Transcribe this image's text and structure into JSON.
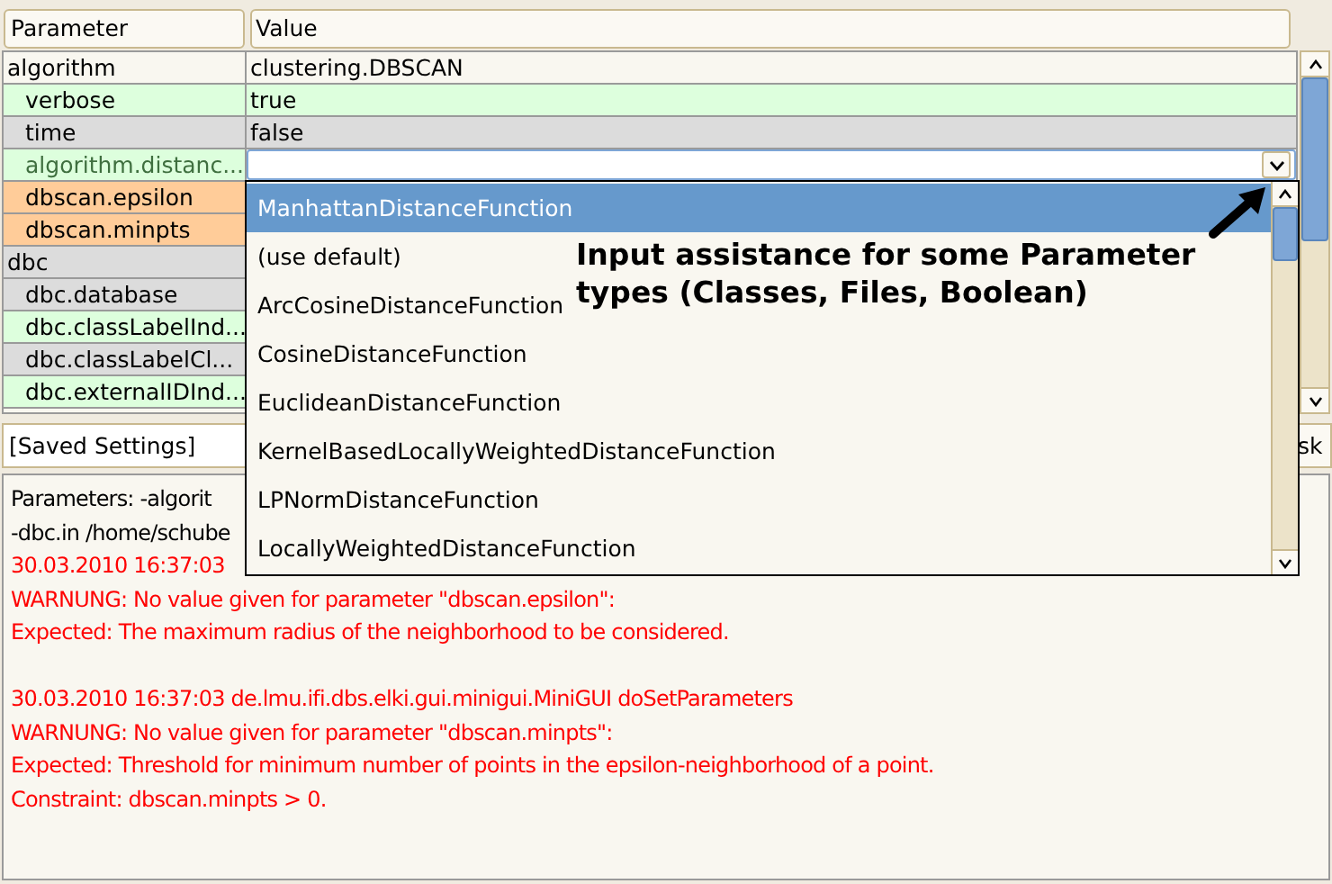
{
  "table": {
    "columns": [
      "Parameter",
      "Value"
    ],
    "rows": [
      {
        "parameter": "algorithm",
        "value": "clustering.DBSCAN",
        "color": "#f9f7f0",
        "editing": false,
        "children": [
          {
            "parameter": "verbose",
            "value": "true",
            "color": "#ddffdd",
            "editing": false
          },
          {
            "parameter": "time",
            "value": "false",
            "color": "#dcdcdc",
            "editing": false
          },
          {
            "parameter": "algorithm.distanc...",
            "color": "#ddffdd",
            "editing": true
          },
          {
            "parameter": "dbscan.epsilon",
            "color": "#ffcc99",
            "editing": false
          },
          {
            "parameter": "dbscan.minpts",
            "color": "#ffcc99",
            "editing": false
          }
        ]
      },
      {
        "parameter": "dbc",
        "color": "#dcdcdc",
        "editing": false,
        "children": [
          {
            "parameter": "dbc.database",
            "color": "#dcdcdc",
            "editing": false
          },
          {
            "parameter": "dbc.classLabelInd...",
            "color": "#ddffdd",
            "editing": false
          },
          {
            "parameter": "dbc.classLabelCl...",
            "color": "#dcdcdc",
            "editing": false
          },
          {
            "parameter": "dbc.externalIDInd...",
            "color": "#ddffdd",
            "editing": false
          }
        ]
      }
    ]
  },
  "dropdown": {
    "options": [
      {
        "label": "ManhattanDistanceFunction",
        "selected": true
      },
      {
        "label": "(use default)",
        "selected": false
      },
      {
        "label": "ArcCosineDistanceFunction",
        "selected": false
      },
      {
        "label": "CosineDistanceFunction",
        "selected": false
      },
      {
        "label": "EuclideanDistanceFunction",
        "selected": false
      },
      {
        "label": "KernelBasedLocallyWeightedDistanceFunction",
        "selected": false
      },
      {
        "label": "LPNormDistanceFunction",
        "selected": false
      },
      {
        "label": "LocallyWeightedDistanceFunction",
        "selected": false
      }
    ]
  },
  "annotation": "Input assistance for some Parameter types (Classes, Files, Boolean)",
  "settings_combo": {
    "value": "[Saved Settings]"
  },
  "task_button": "sk",
  "log": [
    {
      "kind": "info",
      "text": "Parameters: -algorit"
    },
    {
      "kind": "info",
      "text": "-dbc.in /home/schube"
    },
    {
      "kind": "warning",
      "text": "30.03.2010 16:37:03"
    },
    {
      "kind": "warning",
      "text": "WARNUNG: No value given for parameter \"dbscan.epsilon\":"
    },
    {
      "kind": "warning",
      "text": "Expected: The maximum radius of the neighborhood to be considered."
    },
    {
      "kind": "blank"
    },
    {
      "kind": "warning",
      "text": "30.03.2010 16:37:03 de.lmu.ifi.dbs.elki.gui.minigui.MiniGUI doSetParameters"
    },
    {
      "kind": "warning",
      "text": "WARNUNG: No value given for parameter \"dbscan.minpts\":"
    },
    {
      "kind": "warning",
      "text": "Expected: Threshold for minimum number of points in the epsilon-neighborhood of a point."
    },
    {
      "kind": "warning",
      "text": "Constraint: dbscan.minpts > 0."
    }
  ]
}
